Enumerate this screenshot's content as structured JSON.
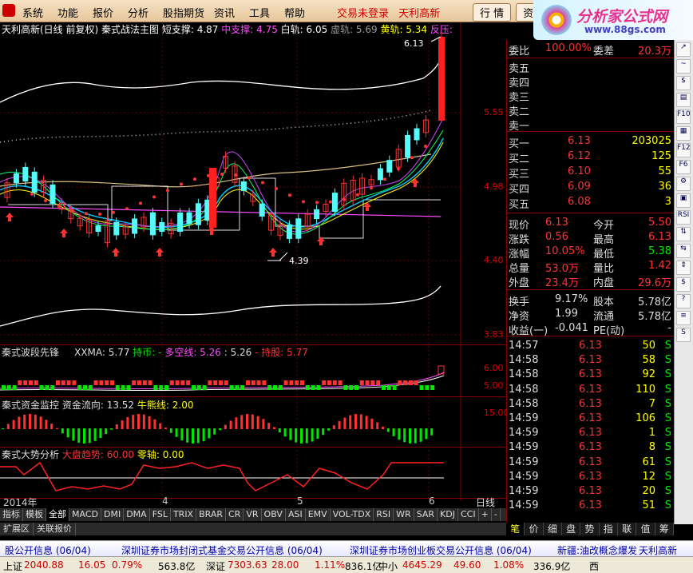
{
  "menu": [
    "系统",
    "功能",
    "报价",
    "分析",
    "股指期货",
    "资讯",
    "工具",
    "帮助"
  ],
  "menu_red": [
    "交易未登录",
    "天利高新"
  ],
  "menu_btns": [
    "行 情",
    "资"
  ],
  "logo": {
    "title": "分析家公式网",
    "url": "www.88gs.com"
  },
  "chart_title": {
    "name": "天利高新(日线 前复权)",
    "formula": "秦式战法主图",
    "short_support": "短支撑: 4.87",
    "mid_support": "中支撑: 4.75",
    "white_track": "白轨: 6.05",
    "virtual_track": "虚轨: 5.69",
    "yellow_track": "黄轨: 5.34",
    "pressure": "反压:"
  },
  "price_labels": [
    "5.55",
    "4.98",
    "4.40",
    "3.83"
  ],
  "annot": {
    "high": "6.13",
    "low": "4.39"
  },
  "sub1": {
    "name": "秦式波段先锋",
    "xxma": "XXMA: 5.77",
    "chishi": "持币: -",
    "duokong": "多空线: 5.26",
    "v2": ": 5.26",
    "chigu": "- 持股: 5.77",
    "r1": "6.00",
    "r2": "5.00"
  },
  "sub2": {
    "name": "秦式资金监控",
    "flow": "资金流向: 13.52",
    "bull": "牛熊线: 2.00",
    "r1": "15.00"
  },
  "sub3": {
    "name": "秦式大势分析",
    "trend": "大盘趋势: 60.00",
    "zero": "零轴: 0.00"
  },
  "dates": {
    "d1": "2014年",
    "d2": "4",
    "d3": "5",
    "d4": "6",
    "right": "日线"
  },
  "tabs": [
    "指标",
    "模板",
    "全部",
    "MACD",
    "DMI",
    "DMA",
    "FSL",
    "TRIX",
    "BRAR",
    "CR",
    "VR",
    "OBV",
    "ASI",
    "EMV",
    "VOL-TDX",
    "RSI",
    "WR",
    "SAR",
    "KDJ",
    "CCI"
  ],
  "tabs2": [
    "扩展区",
    "关联报价"
  ],
  "rtabs": [
    "笔",
    "价",
    "细",
    "盘",
    "势",
    "指",
    "联",
    "值",
    "筹"
  ],
  "wei": {
    "label1": "委比",
    "val1": "100.00%",
    "label2": "委差",
    "val2": "20.3万"
  },
  "asks": [
    {
      "l": "卖五",
      "p": "",
      "v": ""
    },
    {
      "l": "卖四",
      "p": "",
      "v": ""
    },
    {
      "l": "卖三",
      "p": "",
      "v": ""
    },
    {
      "l": "卖二",
      "p": "",
      "v": ""
    },
    {
      "l": "卖一",
      "p": "",
      "v": ""
    }
  ],
  "bids": [
    {
      "l": "买一",
      "p": "6.13",
      "v": "203025"
    },
    {
      "l": "买二",
      "p": "6.12",
      "v": "125"
    },
    {
      "l": "买三",
      "p": "6.10",
      "v": "55"
    },
    {
      "l": "买四",
      "p": "6.09",
      "v": "36"
    },
    {
      "l": "买五",
      "p": "6.08",
      "v": "3"
    }
  ],
  "quote": [
    {
      "l1": "现价",
      "v1": "6.13",
      "l2": "今开",
      "v2": "5.50"
    },
    {
      "l1": "涨跌",
      "v1": "0.56",
      "l2": "最高",
      "v2": "6.13"
    },
    {
      "l1": "涨幅",
      "v1": "10.05%",
      "l2": "最低",
      "v2": "5.38"
    },
    {
      "l1": "总量",
      "v1": "53.0万",
      "l2": "量比",
      "v2": "1.42"
    },
    {
      "l1": "外盘",
      "v1": "23.4万",
      "l2": "内盘",
      "v2": "29.6万"
    }
  ],
  "quote2": [
    {
      "l1": "换手",
      "v1": "9.17%",
      "l2": "股本",
      "v2": "5.78亿"
    },
    {
      "l1": "净资",
      "v1": "1.99",
      "l2": "流通",
      "v2": "5.78亿"
    },
    {
      "l1": "收益(一)",
      "v1": "-0.041",
      "l2": "PE(动)",
      "v2": "-"
    }
  ],
  "trades": [
    {
      "t": "14:57",
      "p": "6.13",
      "v": "50",
      "s": "S"
    },
    {
      "t": "14:58",
      "p": "6.13",
      "v": "58",
      "s": "S"
    },
    {
      "t": "14:58",
      "p": "6.13",
      "v": "92",
      "s": "S"
    },
    {
      "t": "14:58",
      "p": "6.13",
      "v": "110",
      "s": "S"
    },
    {
      "t": "14:58",
      "p": "6.13",
      "v": "7",
      "s": "S"
    },
    {
      "t": "14:59",
      "p": "6.13",
      "v": "106",
      "s": "S"
    },
    {
      "t": "14:59",
      "p": "6.13",
      "v": "1",
      "s": "S"
    },
    {
      "t": "14:59",
      "p": "6.13",
      "v": "8",
      "s": "S"
    },
    {
      "t": "14:59",
      "p": "6.13",
      "v": "61",
      "s": "S"
    },
    {
      "t": "14:59",
      "p": "6.13",
      "v": "12",
      "s": "S"
    },
    {
      "t": "14:59",
      "p": "6.13",
      "v": "20",
      "s": "S"
    },
    {
      "t": "14:59",
      "p": "6.13",
      "v": "51",
      "s": "S"
    }
  ],
  "ticker": [
    "股公开信息 (06/04)",
    "深圳证券市场封闭式基金交易公开信息 (06/04)",
    "深圳证券市场创业板交易公开信息 (06/04)",
    "新疆:油改概念爆发",
    "天利高新"
  ],
  "status": {
    "sh": "上证",
    "sh_v": "2040.88",
    "sh_c": "16.05",
    "sh_p": "0.79%",
    "sh_a": "563.8亿",
    "sz": "深证",
    "sz_v": "7303.63",
    "sz_c": "28.00",
    "sz_p": "1.11%",
    "sz_a": "836.1亿",
    "zx": "中小",
    "zx_v": "4645.29",
    "zx_c": "49.60",
    "zx_p": "1.08%",
    "zx_a": "336.9亿",
    "ext": "西"
  },
  "sidebar": [
    "↗",
    "~",
    "$",
    "▤",
    "F10",
    "▦",
    "F12",
    "F6",
    "⚙",
    "▣",
    "RSI",
    "⇅",
    "⇆",
    "⇕",
    "$",
    "?",
    "≡",
    "S"
  ],
  "colors": {
    "up": "#ff3232",
    "down": "#00e600",
    "accent": "#ffff00"
  }
}
